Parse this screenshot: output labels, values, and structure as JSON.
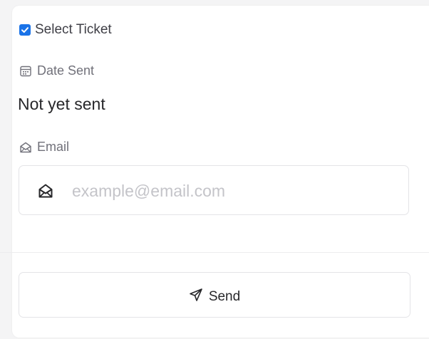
{
  "ticket": {
    "select_label": "Select Ticket",
    "select_checked": true
  },
  "date_sent": {
    "label": "Date Sent",
    "label_icon": "calendar-icon",
    "value": "Not yet sent"
  },
  "email": {
    "label": "Email",
    "label_icon": "envelope-open-icon",
    "placeholder": "example@email.com",
    "value": ""
  },
  "actions": {
    "send_label": "Send",
    "send_icon": "send-icon"
  },
  "colors": {
    "checkbox": "#1a73e8",
    "background": "#f4f4f5",
    "card": "#ffffff"
  }
}
